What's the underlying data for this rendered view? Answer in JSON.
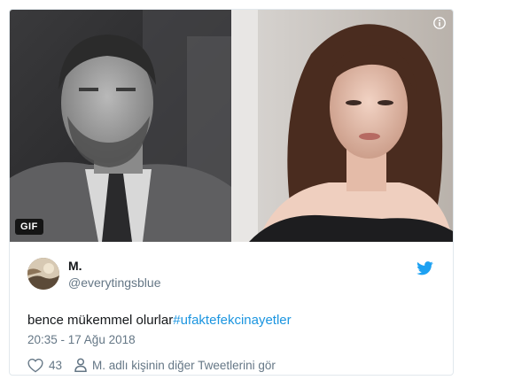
{
  "media": {
    "gif_label": "GIF",
    "info_icon": "info-icon"
  },
  "tweet": {
    "author_name": "M.",
    "author_handle": "@everytingsblue",
    "text_plain": "bence mükemmel olurlar",
    "text_hashtag": "#ufaktefekcinayetler",
    "timestamp": "20:35 - 17 Ağu 2018",
    "like_count": "43",
    "profile_link": "M. adlı kişinin diğer Tweetlerini gör",
    "brand_icon": "twitter-bird-icon",
    "colors": {
      "link": "#1b95e0",
      "brand": "#1da1f2",
      "muted": "#657786"
    }
  }
}
